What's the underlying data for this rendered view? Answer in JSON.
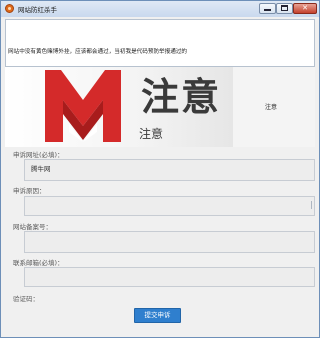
{
  "window": {
    "title": "网站防红杀手",
    "icon": "app-logo-icon",
    "controls": {
      "minimize": "minimize-icon",
      "maximize": "maximize-icon",
      "close": "✕"
    }
  },
  "notice": {
    "text": "网站中没有黄色赌博外挂，应该都会通过，当初我是代码预防举报通过的"
  },
  "banner": {
    "logo": "red-m-logo",
    "big_text": "注意",
    "small_text": "注意",
    "right_text": "注意"
  },
  "form": {
    "fields": [
      {
        "label": "申诉网址(必填)：",
        "value": "腾牛网"
      },
      {
        "label": "申诉原因：",
        "value": ""
      },
      {
        "label": "网站备案号：",
        "value": ""
      },
      {
        "label": "联系邮箱(必填)：",
        "value": ""
      },
      {
        "label": "验证码：",
        "value": ""
      }
    ],
    "submit_label": "提交申诉"
  },
  "colors": {
    "accent": "#2f7fce",
    "logo_red": "#d42a2a",
    "field_bg": "#ededed"
  }
}
